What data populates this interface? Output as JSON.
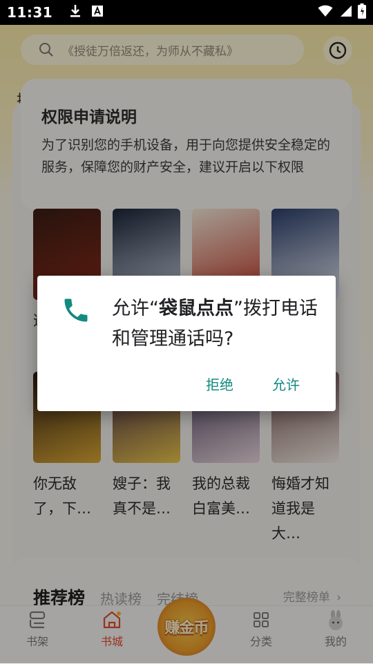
{
  "status_bar": {
    "time": "11:31"
  },
  "search": {
    "placeholder": "《授徒万倍返还，为师从不藏私》"
  },
  "side_char": "推",
  "permission_notice": {
    "title": "权限申请说明",
    "body": "为了识别您的手机设备，用于向您提供安全稳定的服务，保障您的财产安全，建议开启以下权限"
  },
  "books_row1": [
    {
      "title": "逆",
      "cover_colors": [
        "#3a1d14",
        "#8a2a1a"
      ]
    },
    {
      "title": "",
      "cover_colors": [
        "#1c2438",
        "#c9d3e0"
      ]
    },
    {
      "title": "",
      "cover_colors": [
        "#f2e6d6",
        "#c23a2a"
      ]
    },
    {
      "title": "",
      "cover_colors": [
        "#2c3e6a",
        "#e7ecf4"
      ]
    }
  ],
  "books_row2": [
    {
      "title": "你无敌了，下…",
      "cover_colors": [
        "#2a1a12",
        "#d8a634"
      ]
    },
    {
      "title": "嫂子：我真不是…",
      "cover_colors": [
        "#3a1f4a",
        "#e8c44a"
      ]
    },
    {
      "title": "我的总裁白富美…",
      "cover_colors": [
        "#403a55",
        "#e9d4dc"
      ]
    },
    {
      "title": "悔婚才知道我是大…",
      "cover_colors": [
        "#6d4a4a",
        "#f2e9e2"
      ]
    }
  ],
  "rank": {
    "tabs": [
      "推荐榜",
      "热读榜",
      "完结榜"
    ],
    "more": "完整榜单"
  },
  "nav": {
    "items": [
      "书架",
      "书城",
      "分类",
      "我的"
    ],
    "earn": "赚金币",
    "active_color": "#e04a2a"
  },
  "dialog": {
    "message_prefix": "允许“",
    "app_name": "袋鼠点点",
    "message_suffix": "”拨打电话和管理通话吗?",
    "deny": "拒绝",
    "allow": "允许",
    "icon": "phone-icon",
    "accent": "#128a80"
  }
}
